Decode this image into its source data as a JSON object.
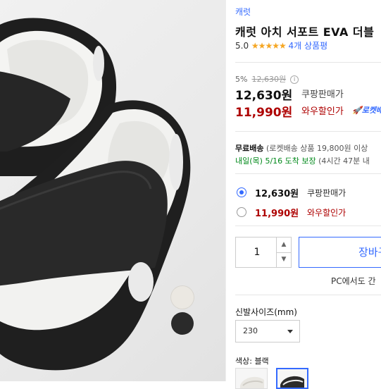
{
  "product": {
    "brand": "캐럿",
    "title": "캐럿 아치 서포트 EVA 더블",
    "rating": "5.0",
    "stars": "★★★★★",
    "review_count": "4개 상품평"
  },
  "price": {
    "discount_rate": "5%",
    "original": "12,630원",
    "sale_price": "12,630원",
    "sale_label": "쿠팡판매가",
    "wow_price": "11,990원",
    "wow_label": "와우할인가",
    "rocket_badge": "🚀로켓배"
  },
  "shipping": {
    "label": "무료배송",
    "detail": "(로켓배송 상품 19,800원 이상",
    "arrival": "내일(목) 5/16 도착 보장",
    "arrival_sub": "(4시간 47분  내"
  },
  "price_options": [
    {
      "price": "12,630원",
      "label": "쿠팡판매가",
      "selected": true
    },
    {
      "price": "11,990원",
      "label": "와우할인가",
      "selected": false
    }
  ],
  "purchase": {
    "quantity": "1",
    "buy_button": "장바구",
    "pc_note": "PC에서도 간"
  },
  "size": {
    "label": "신발사이즈(mm)",
    "selected": "230"
  },
  "color": {
    "label": "색상: 블랙"
  },
  "swatches": [
    {
      "name": "white",
      "color": "#ebe8e2"
    },
    {
      "name": "black",
      "color": "#2a2a2a"
    }
  ],
  "colors": {
    "accent": "#346aff",
    "wow_red": "#ae0000",
    "star": "#f5a623",
    "arrival_green": "#00891a"
  },
  "icons": {
    "rating": "star-icon",
    "info": "info-icon",
    "qty_up": "chevron-up-icon",
    "qty_down": "chevron-down-icon",
    "select": "caret-down-icon"
  }
}
